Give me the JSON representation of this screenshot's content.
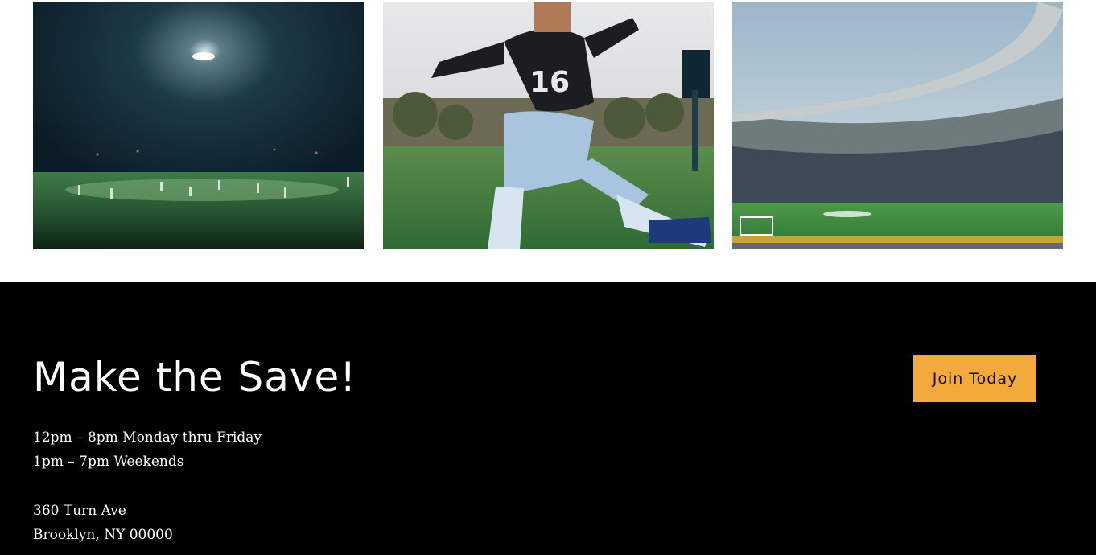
{
  "gallery": {
    "photos": [
      {
        "icon": "night-stadium-photo"
      },
      {
        "icon": "soccer-player-kick-photo"
      },
      {
        "icon": "stadium-interior-photo"
      }
    ]
  },
  "footer": {
    "title": "Make the Save!",
    "join_label": "Join Today",
    "hours": [
      "12pm – 8pm Monday thru Friday",
      "1pm – 7pm Weekends"
    ],
    "address": [
      "360 Turn Ave",
      "Brooklyn, NY 00000"
    ]
  },
  "colors": {
    "footer_bg": "#000000",
    "accent": "#f4a93b",
    "text": "#ffffff"
  }
}
